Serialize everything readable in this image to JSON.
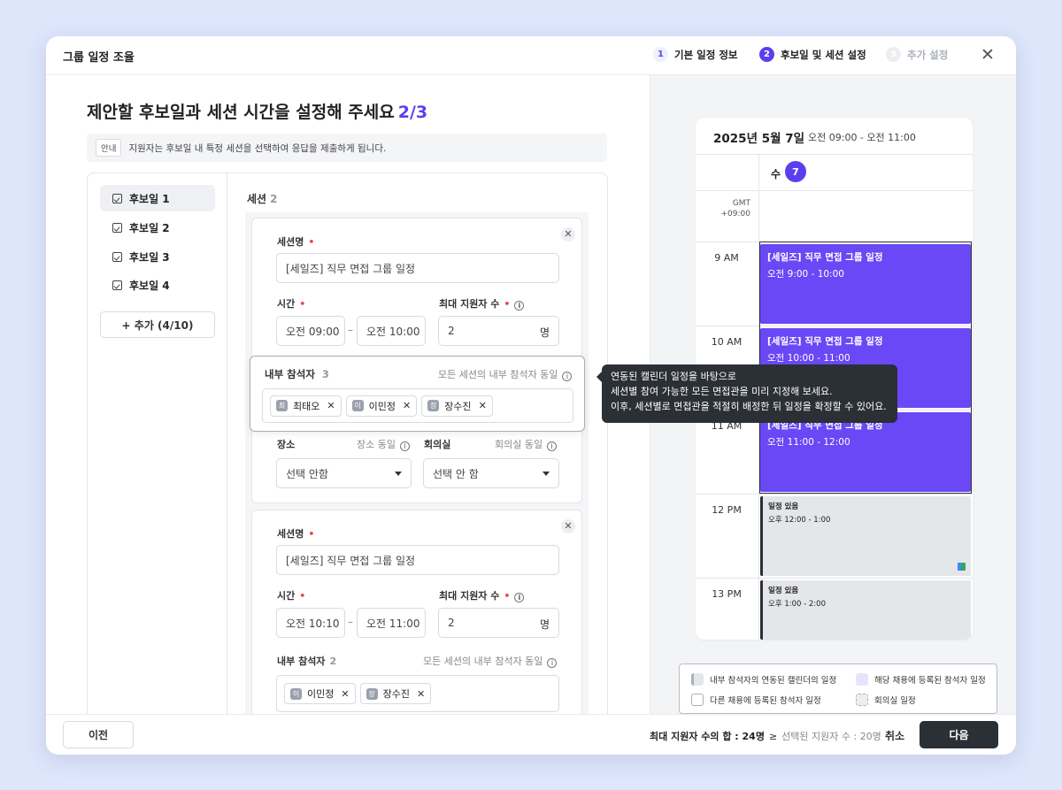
{
  "header": {
    "title": "그룹 일정 조율",
    "steps": [
      {
        "num": "1",
        "label": "기본 일정 정보"
      },
      {
        "num": "2",
        "label": "후보일 및 세션 설정"
      },
      {
        "num": "3",
        "label": "추가 설정"
      }
    ],
    "close_icon": "✕"
  },
  "page": {
    "title": "제안할 후보일과 세션 시간을 설정해 주세요",
    "progress": "2/3",
    "notice_tag": "안내",
    "notice_text": "지원자는 후보일 내 특정 세션을 선택하여 응답을 제출하게 됩니다."
  },
  "sidebar": {
    "items": [
      {
        "label": "후보일 1"
      },
      {
        "label": "후보일 2"
      },
      {
        "label": "후보일 3"
      },
      {
        "label": "후보일 4"
      }
    ],
    "add_label": "+ 추가 (4/10)"
  },
  "sessions": {
    "label": "세션",
    "count": "2",
    "items": [
      {
        "name_label": "세션명",
        "name_value": "[세일즈] 직무 면접 그룹 일정",
        "time_label": "시간",
        "start": "오전 09:00",
        "end": "오전 10:00",
        "max_label": "최대 지원자 수",
        "max_value": "2",
        "unit": "명",
        "participants_label": "내부 참석자",
        "participants_count": "3",
        "participants_hint": "모든 세션의 내부 참석자 동일",
        "participants": [
          {
            "initial": "최",
            "name": "최태오"
          },
          {
            "initial": "이",
            "name": "이민정"
          },
          {
            "initial": "장",
            "name": "장수진"
          }
        ],
        "place_label": "장소",
        "place_hint": "장소 동일",
        "place_value": "선택 안함",
        "room_label": "회의실",
        "room_hint": "회의실 동일",
        "room_value": "선택 안 함"
      },
      {
        "name_label": "세션명",
        "name_value": "[세일즈] 직무 면접 그룹 일정",
        "time_label": "시간",
        "start": "오전 10:10",
        "end": "오전 11:00",
        "max_label": "최대 지원자 수",
        "max_value": "2",
        "unit": "명",
        "participants_label": "내부 참석자",
        "participants_count": "2",
        "participants_hint": "모든 세션의 내부 참석자 동일",
        "participants": [
          {
            "initial": "이",
            "name": "이민정"
          },
          {
            "initial": "장",
            "name": "장수진"
          }
        ]
      }
    ]
  },
  "tooltip": {
    "lines": [
      "연동된 캘린더 일정을 바탕으로",
      "세션별 참여 가능한 모든 면접관을 미리 지정해 보세요.",
      "이후, 세션별로 면접관을 적절히 배정한 뒤 일정을 확정할 수 있어요."
    ]
  },
  "calendar": {
    "date": "2025년 5월 7일",
    "range": "오전 09:00 - 오전 11:00",
    "dow": "수",
    "day": "7",
    "gmt": [
      "GMT",
      "+09:00"
    ],
    "hours": [
      "9 AM",
      "10 AM",
      "11 AM",
      "12 PM",
      "13 PM"
    ],
    "events": [
      {
        "title": "[세일즈] 직무 면접 그룹 일정",
        "time": "오전 9:00 - 10:00",
        "kind": "session"
      },
      {
        "title": "[세일즈] 직무 면접 그룹 일정",
        "time": "오전 10:00 - 11:00",
        "kind": "session"
      },
      {
        "title": "[세일즈] 직무 면접 그룹 일정",
        "time": "오전 11:00 - 12:00",
        "kind": "session"
      },
      {
        "title": "일정 있음",
        "time": "오후 12:00 - 1:00",
        "kind": "busy"
      },
      {
        "title": "일정 있음",
        "time": "오후 1:00 - 2:00",
        "kind": "busy"
      }
    ],
    "legend": [
      "내부 참석자의 연동된 캘린더의 일정",
      "해당 채용에 등록된 참석자 일정",
      "다른 채용에 등록된 참석자 일정",
      "회의실 일정"
    ]
  },
  "footer": {
    "prev_label": "이전",
    "sum_label": "최대 지원자 수의 합 : 24명",
    "sum_op": "≥",
    "selected_label": "선택된 지원자 수 : 20명",
    "cancel_label": "취소",
    "next_label": "다음"
  },
  "colors": {
    "accent": "#5a3ff0",
    "event": "#6a48f5",
    "dark": "#2b2f36",
    "required": "#e5484d"
  }
}
